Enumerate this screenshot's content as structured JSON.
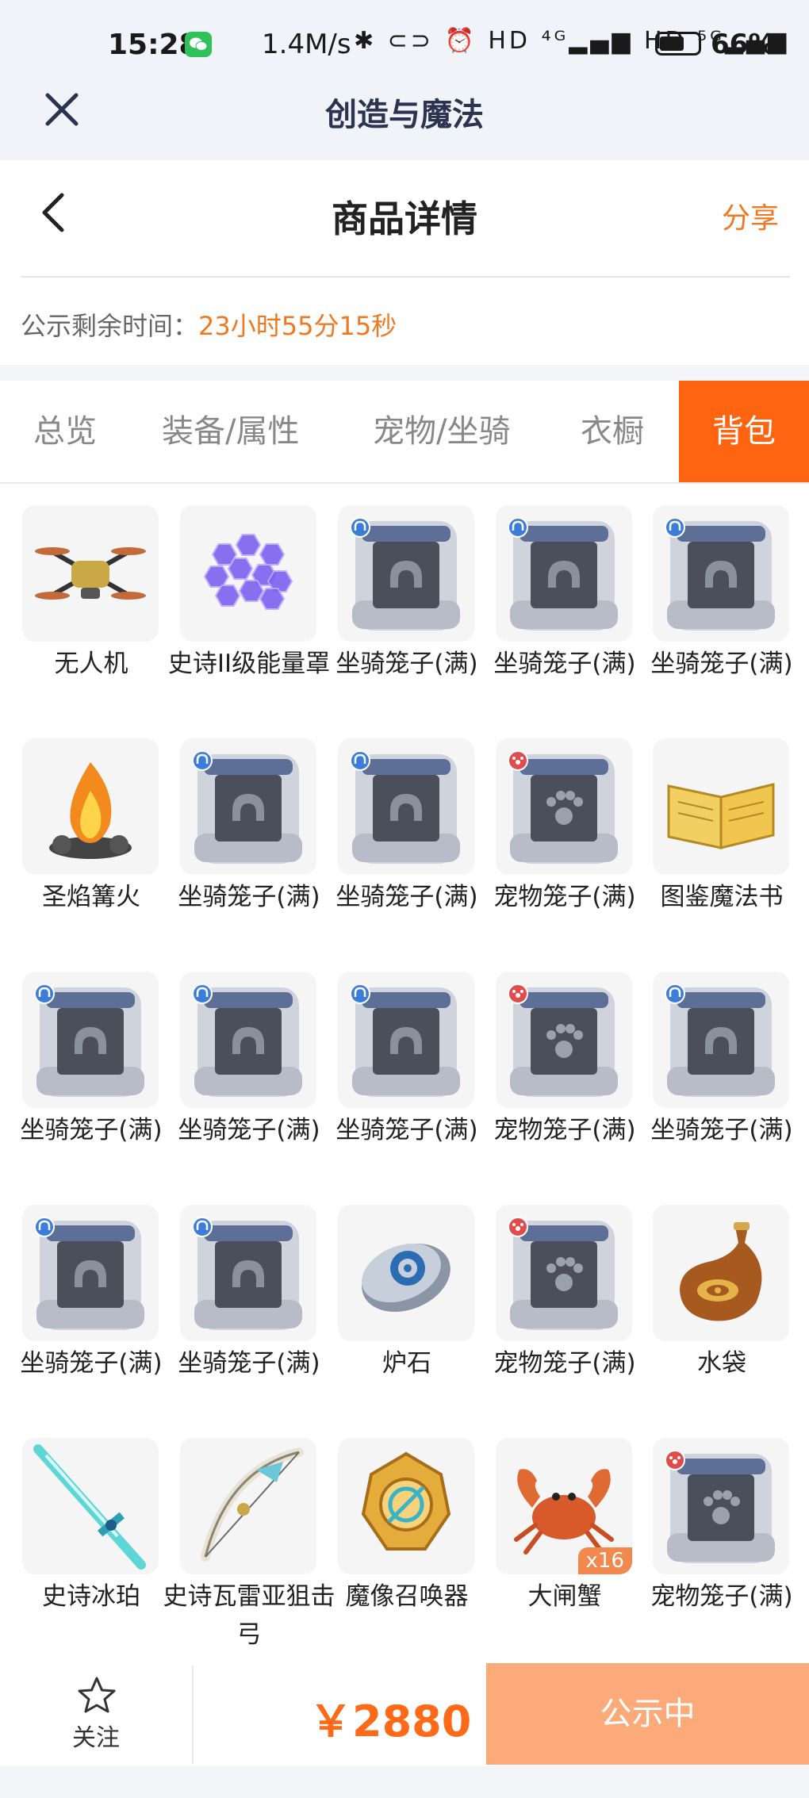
{
  "status_bar": {
    "time": "15:28",
    "network_speed": "1.4M/s",
    "signal_icons": "✱ ⊂⊃ ⏰ HD ⁴ᴳ▂▄▆ HD ⁵ᴳ▂▄▆",
    "battery_level": 0.66,
    "battery_text": "66%"
  },
  "app_bar": {
    "title": "创造与魔法",
    "close_icon": "close-icon"
  },
  "header": {
    "title": "商品详情",
    "share_label": "分享",
    "back_icon": "back-chevron-icon"
  },
  "notice": {
    "label": "公示剩余时间：",
    "value": "23小时55分15秒"
  },
  "tabs": [
    {
      "label": "总览",
      "active": false
    },
    {
      "label": "装备/属性",
      "active": false
    },
    {
      "label": "宠物/坐骑",
      "active": false
    },
    {
      "label": "衣橱",
      "active": false
    },
    {
      "label": "背包",
      "active": true
    }
  ],
  "items": [
    {
      "name": "无人机",
      "icon": "drone-icon"
    },
    {
      "name": "史诗II级能量罩",
      "icon": "energy-shield-icon"
    },
    {
      "name": "坐骑笼子(满)",
      "icon": "mount-cage-icon"
    },
    {
      "name": "坐骑笼子(满)",
      "icon": "mount-cage-icon"
    },
    {
      "name": "坐骑笼子(满)",
      "icon": "mount-cage-icon"
    },
    {
      "name": "圣焰篝火",
      "icon": "bonfire-icon"
    },
    {
      "name": "坐骑笼子(满)",
      "icon": "mount-cage-icon"
    },
    {
      "name": "坐骑笼子(满)",
      "icon": "mount-cage-icon"
    },
    {
      "name": "宠物笼子(满)",
      "icon": "pet-cage-icon"
    },
    {
      "name": "图鉴魔法书",
      "icon": "magic-book-icon"
    },
    {
      "name": "坐骑笼子(满)",
      "icon": "mount-cage-icon"
    },
    {
      "name": "坐骑笼子(满)",
      "icon": "mount-cage-icon"
    },
    {
      "name": "坐骑笼子(满)",
      "icon": "mount-cage-icon"
    },
    {
      "name": "宠物笼子(满)",
      "icon": "pet-cage-icon"
    },
    {
      "name": "坐骑笼子(满)",
      "icon": "mount-cage-icon"
    },
    {
      "name": "坐骑笼子(满)",
      "icon": "mount-cage-icon"
    },
    {
      "name": "坐骑笼子(满)",
      "icon": "mount-cage-icon"
    },
    {
      "name": "炉石",
      "icon": "hearthstone-icon"
    },
    {
      "name": "宠物笼子(满)",
      "icon": "pet-cage-icon"
    },
    {
      "name": "水袋",
      "icon": "water-bag-icon"
    },
    {
      "name": "史诗冰珀",
      "icon": "ice-sword-icon"
    },
    {
      "name": "史诗瓦雷亚狙击弓",
      "icon": "sniper-bow-icon"
    },
    {
      "name": "魔像召唤器",
      "icon": "golem-summoner-icon"
    },
    {
      "name": "大闸蟹",
      "icon": "crab-icon",
      "qty": "x16"
    },
    {
      "name": "宠物笼子(满)",
      "icon": "pet-cage-icon"
    }
  ],
  "footer": {
    "favorite_label": "关注",
    "price": "￥2880",
    "cta_label": "公示中",
    "colors": {
      "price": "#ff6a18",
      "cta": "#fdaa7b",
      "active_tab": "#ff6410"
    }
  }
}
